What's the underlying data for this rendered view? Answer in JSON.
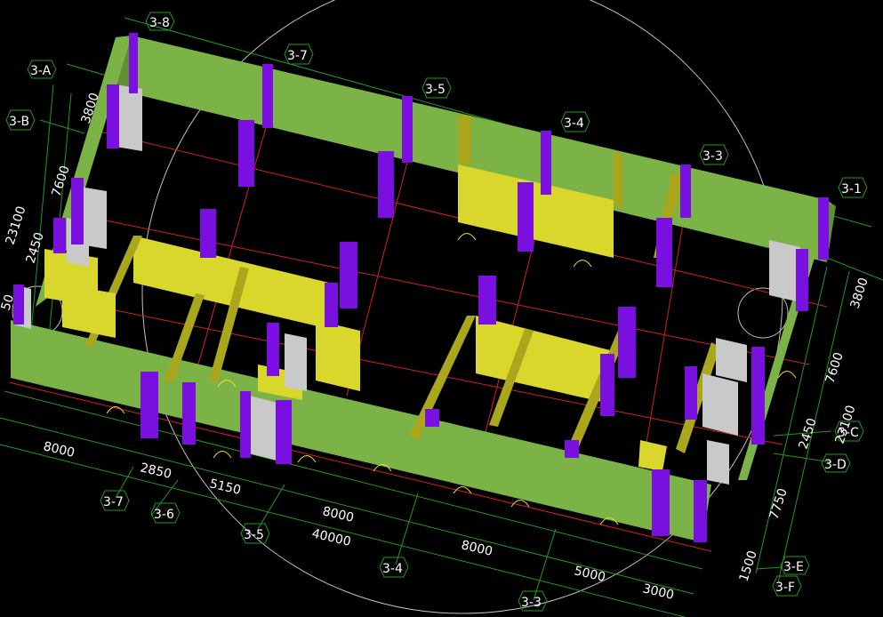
{
  "colors": {
    "background": "#000000",
    "grid_green": "#1f9a1f",
    "axis_red": "#d81f1f",
    "wall_green": "#7bb347",
    "wall_yellow": "#d9d62c",
    "wall_yellow_dark": "#aaa71c",
    "column_purple": "#7a10e0",
    "column_purple_dark": "#4e0a9a",
    "door_gray": "#c9c9c9",
    "door_yellow": "#f0e030",
    "orbit_circle": "#bfbfbf"
  },
  "axis_labels": {
    "a_3_8": "3-8",
    "a_3_7_top": "3-7",
    "a_3_5_top": "3-5",
    "a_3_4_top": "3-4",
    "a_3_3_top": "3-3",
    "a_3_1": "3-1",
    "a_3_A": "3-A",
    "a_3_B": "3-B",
    "a_3_C": "3-C",
    "a_3_D": "3-D",
    "a_3_E": "3-E",
    "a_3_F": "3-F",
    "a_3_7_bot": "3-7",
    "a_3_6_bot": "3-6",
    "a_3_5_bot": "3-5",
    "a_3_4_bot": "3-4",
    "a_3_3_bot": "3-3"
  },
  "dimensions": {
    "d_left_3800": "3800",
    "d_left_7600": "7600",
    "d_left_23100": "23100",
    "d_left_2450": "2450",
    "d_left_50": "50",
    "d_right_3800": "3800",
    "d_right_7600": "7600",
    "d_right_23100": "23100",
    "d_right_2450": "2450",
    "d_right_7750": "7750",
    "d_right_1500": "1500",
    "d_bot_8000_a": "8000",
    "d_bot_2850": "2850",
    "d_bot_5150": "5150",
    "d_bot_8000_b": "8000",
    "d_bot_40000": "40000",
    "d_bot_8000_c": "8000",
    "d_bot_5000": "5000",
    "d_bot_3000": "3000"
  }
}
